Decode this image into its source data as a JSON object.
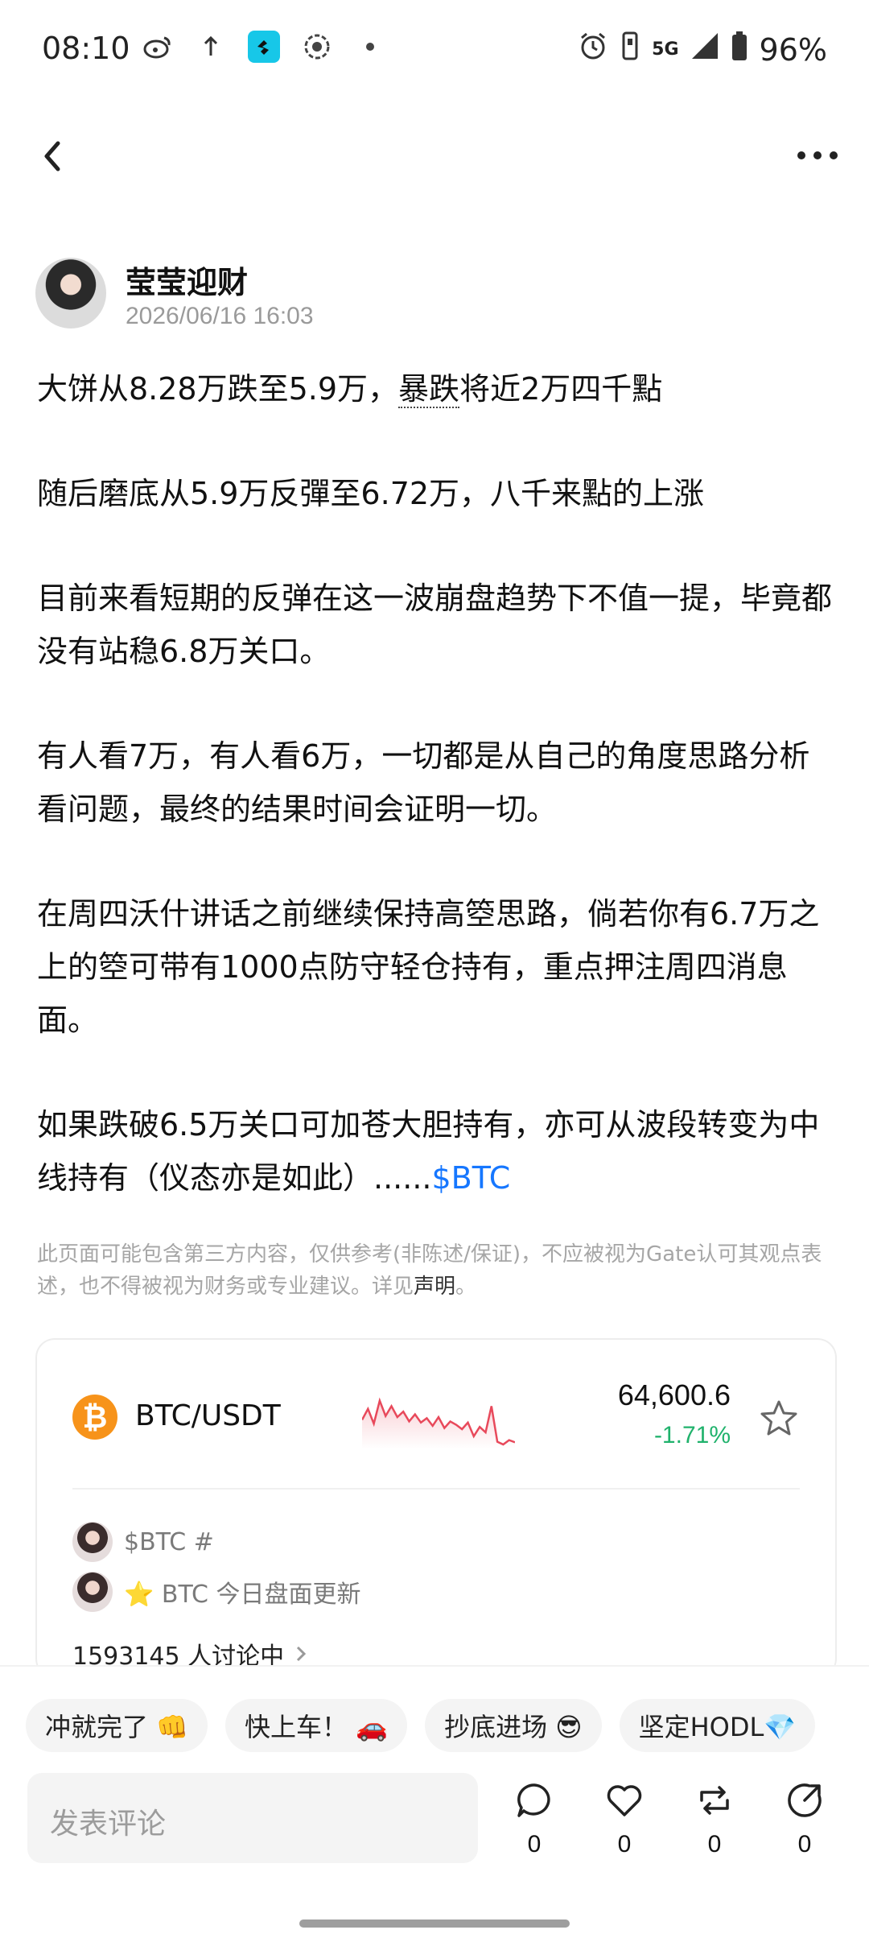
{
  "status_bar": {
    "time": "08:10",
    "network": "5G",
    "battery": "96%",
    "left_icons": [
      "weibo-icon",
      "upload-arrow-icon",
      "app-icon",
      "screen-record-icon",
      "dot-icon"
    ],
    "right_icons": [
      "alarm-icon",
      "vibrate-icon",
      "5g-icon",
      "signal-icon",
      "battery-icon"
    ]
  },
  "author": {
    "name": "莹莹迎财",
    "date": "2026/06/16 16:03"
  },
  "post": {
    "p1_a": "大饼从8.28万跌至5.9万，",
    "p1_b": "暴跌",
    "p1_c": "将近2万四千點",
    "p2": "随后磨底从5.9万反彈至6.72万，八千来點的上涨",
    "p3": "目前来看短期的反弹在这一波崩盘趋势下不值一提，毕竟都没有站稳6.8万关口。",
    "p4": "有人看7万，有人看6万，一切都是从自己的角度思路分析看问题，最终的结果时间会证明一切。",
    "p5": "在周四沃什讲话之前继续保持高箜思路，倘若你有6.7万之上的箜可带有1000点防守轻仓持有，重点押注周四消息面。",
    "p6": "如果跌破6.5万关口可加苍大胆持有，亦可从波段转变为中线持有（仪态亦是如此）......",
    "tag": "$BTC"
  },
  "disclaimer": {
    "text": "此页面可能包含第三方内容，仅供参考(非陈述/保证)，不应被视为Gate认可其观点表述，也不得被视为财务或专业建议。详见",
    "link": "声明",
    "end": "。"
  },
  "market": {
    "coin_symbol": "₿",
    "pair": "BTC/USDT",
    "price": "64,600.6",
    "change": "-1.71%",
    "sparkline": [
      0.55,
      0.35,
      0.62,
      0.2,
      0.48,
      0.3,
      0.5,
      0.4,
      0.58,
      0.45,
      0.6,
      0.52,
      0.66,
      0.5,
      0.7,
      0.58,
      0.64,
      0.72,
      0.6,
      0.85,
      0.68,
      0.78,
      0.3,
      0.95,
      1.0,
      0.92,
      0.96
    ],
    "trend_color": "#e8495b",
    "topics": [
      "$BTC #",
      "⭐ BTC 今日盘面更新"
    ],
    "discussing": "1593145 人讨论中"
  },
  "quick_replies": [
    "冲就完了 👊",
    "快上车！ 🚗",
    "抄底进场 😎",
    "坚定HODL💎"
  ],
  "comment": {
    "placeholder": "发表评论"
  },
  "actions": {
    "comments": "0",
    "likes": "0",
    "reposts": "0",
    "shares": "0"
  }
}
